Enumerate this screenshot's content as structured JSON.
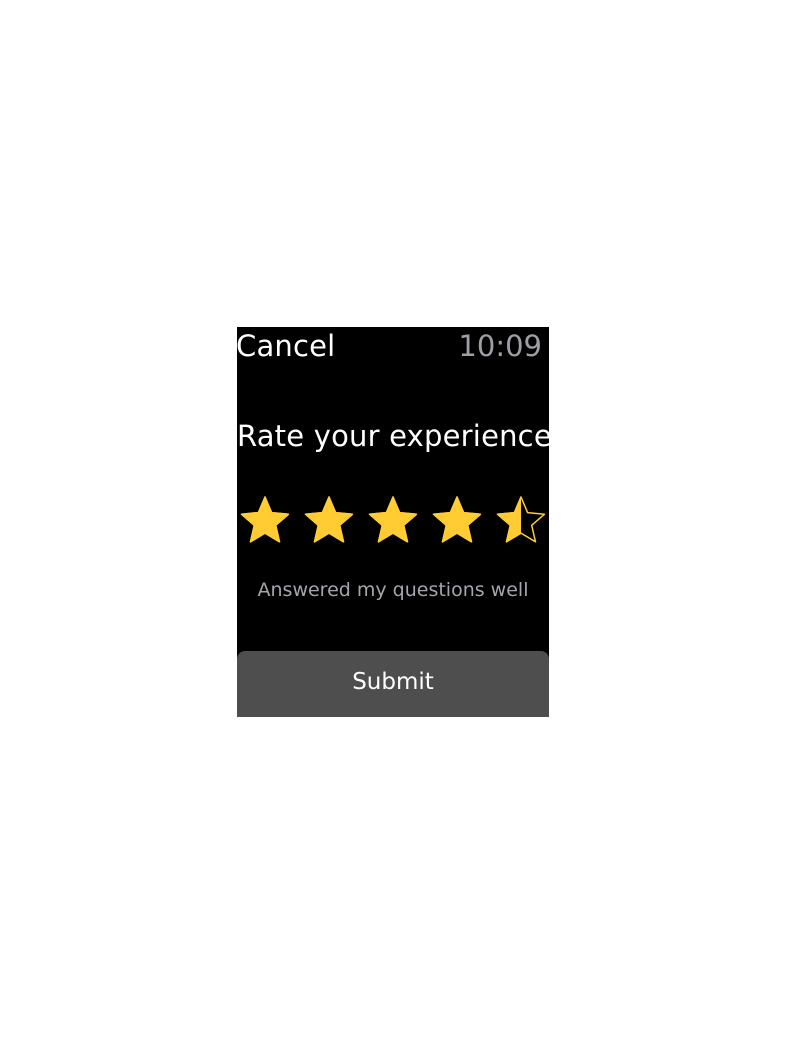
{
  "status_bar": {
    "cancel_label": "Cancel",
    "time": "10:09"
  },
  "rating": {
    "title": "Rate your experience",
    "value": 4.5,
    "max": 5,
    "caption": "Answered my questions well",
    "star_color": "#ffcc33",
    "star_icon": "star-icon"
  },
  "submit_label": "Submit"
}
